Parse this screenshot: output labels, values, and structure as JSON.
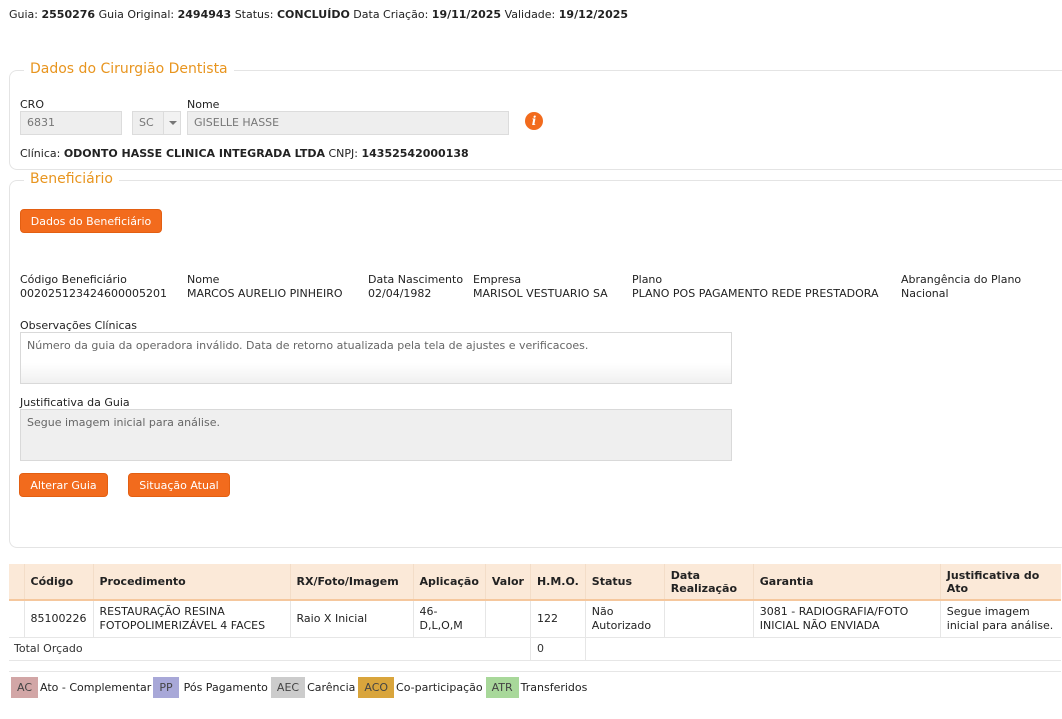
{
  "header": {
    "guia_label": "Guia:",
    "guia_value": "2550276",
    "original_label": "Guia Original:",
    "original_value": "2494943",
    "status_label": "Status:",
    "status_value": "CONCLUÍDO",
    "criacao_label": "Data Criação:",
    "criacao_value": "19/11/2025",
    "validade_label": "Validade:",
    "validade_value": "19/12/2025"
  },
  "dentista": {
    "legend": "Dados do Cirurgião Dentista",
    "cro_label": "CRO",
    "cro_value": "6831",
    "uf_value": "SC",
    "nome_label": "Nome",
    "nome_value": "GISELLE HASSE",
    "info_icon_glyph": "i",
    "clinica_label": "Clínica:",
    "clinica_value": "ODONTO HASSE CLINICA INTEGRADA LTDA",
    "cnpj_label": "CNPJ:",
    "cnpj_value": "14352542000138"
  },
  "beneficiario": {
    "legend": "Beneficiário",
    "dados_button": "Dados do Beneficiário",
    "fields": [
      {
        "label": "Código Beneficiário",
        "value": "002025123424600005201"
      },
      {
        "label": "Nome",
        "value": "MARCOS AURELIO PINHEIRO"
      },
      {
        "label": "Data Nascimento",
        "value": "02/04/1982"
      },
      {
        "label": "Empresa",
        "value": "MARISOL VESTUARIO SA"
      },
      {
        "label": "Plano",
        "value": "PLANO POS PAGAMENTO REDE PRESTADORA"
      },
      {
        "label": "Abrangência do Plano",
        "value": "Nacional"
      }
    ],
    "obs_label": "Observações Clínicas",
    "obs_value": "Número da guia da operadora inválido. Data de retorno atualizada pela tela de ajustes e verificacoes.",
    "just_label": "Justificativa da Guia",
    "just_value": "Segue imagem inicial para análise.",
    "alterar_button": "Alterar Guia",
    "situacao_button": "Situação Atual"
  },
  "table": {
    "headers": [
      "Código",
      "Procedimento",
      "RX/Foto/Imagem",
      "Aplicação",
      "Valor",
      "H.M.O.",
      "Status",
      "Data Realização",
      "Garantia",
      "Justificativa do Ato"
    ],
    "row": {
      "codigo": "85100226",
      "procedimento": "RESTAURAÇÃO RESINA FOTOPOLIMERIZÁVEL 4 FACES",
      "rx": "Raio X Inicial",
      "aplicacao": "46-D,L,O,M",
      "valor": "",
      "hmo": "122",
      "status": "Não Autorizado",
      "data_realizacao": "",
      "garantia": "3081 - RADIOGRAFIA/FOTO INICIAL NÃO ENVIADA",
      "justificativa": "Segue imagem inicial para análise."
    },
    "total_label": "Total Orçado",
    "total_hmo": "0"
  },
  "legend_chips": [
    {
      "code": "AC",
      "text": "Ato - Complementar",
      "color": "#d2a6a6"
    },
    {
      "code": "PP",
      "text": "Pós Pagamento",
      "color": "#a8a8d8"
    },
    {
      "code": "AEC",
      "text": "Carência",
      "color": "#cccccc"
    },
    {
      "code": "ACO",
      "text": "Co-participação",
      "color": "#d9a53c"
    },
    {
      "code": "ATR",
      "text": "Transferidos",
      "color": "#a8d89a"
    }
  ]
}
